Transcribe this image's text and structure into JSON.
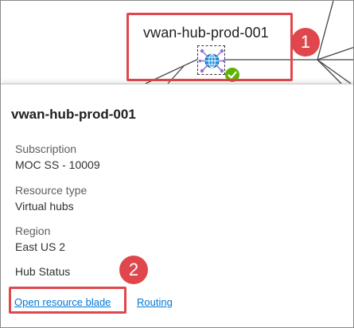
{
  "topology": {
    "hub_title": "vwan-hub-prod-001",
    "hub_icon": "globe-icon",
    "status_icon": "checkmark-icon",
    "status_color": "#5db300"
  },
  "callouts": {
    "one": "1",
    "two": "2",
    "color": "#e0474c"
  },
  "panel": {
    "title": "vwan-hub-prod-001",
    "fields": [
      {
        "label": "Subscription",
        "value": "MOC SS - 10009"
      },
      {
        "label": "Resource type",
        "value": "Virtual hubs"
      },
      {
        "label": "Region",
        "value": "East US 2"
      },
      {
        "label": "Hub Status",
        "value": ""
      }
    ],
    "links": {
      "open_resource_blade": "Open resource blade",
      "routing": "Routing"
    },
    "link_color": "#0078d4"
  }
}
